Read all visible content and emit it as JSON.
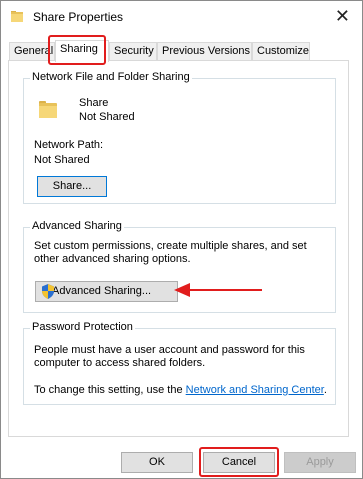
{
  "window": {
    "title": "Share Properties",
    "close_glyph": "✕"
  },
  "tabs": [
    {
      "label": "General"
    },
    {
      "label": "Sharing"
    },
    {
      "label": "Security"
    },
    {
      "label": "Previous Versions"
    },
    {
      "label": "Customize"
    }
  ],
  "network_sharing": {
    "legend": "Network File and Folder Sharing",
    "folder_name": "Share",
    "folder_status": "Not Shared",
    "path_label": "Network Path:",
    "path_value": "Not Shared",
    "share_button": "Share..."
  },
  "advanced_sharing": {
    "legend": "Advanced Sharing",
    "description": "Set custom permissions, create multiple shares, and set other advanced sharing options.",
    "button": "Advanced Sharing..."
  },
  "password_protection": {
    "legend": "Password Protection",
    "description": "People must have a user account and password for this computer to access shared folders.",
    "change_text": "To change this setting, use the ",
    "link": "Network and Sharing Center",
    "link_suffix": "."
  },
  "footer": {
    "ok": "OK",
    "cancel": "Cancel",
    "apply": "Apply"
  },
  "colors": {
    "highlight_red": "#e11d1d",
    "link_blue": "#0066cc",
    "focus_blue": "#0078d7"
  }
}
